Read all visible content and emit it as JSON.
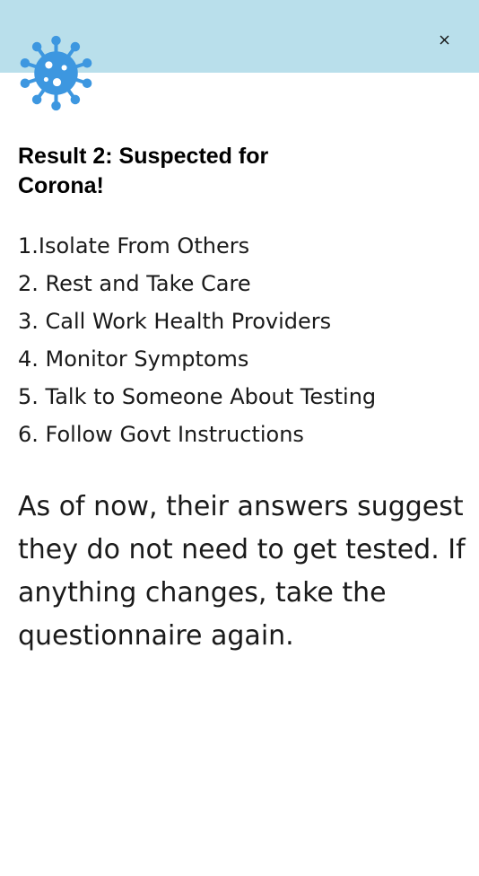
{
  "colors": {
    "header_background": "#b9dfeb",
    "virus_icon": "#3d97e0",
    "page_background": "#ffffff",
    "text": "#1a1a1a"
  },
  "header": {
    "close_label": "×",
    "close_icon": "close-icon",
    "logo_icon": "virus-icon"
  },
  "result": {
    "title": "Result 2: Suspected for Corona!"
  },
  "steps": [
    "1.Isolate From Others",
    "2. Rest and Take Care",
    "3. Call Work Health Providers",
    "4. Monitor Symptoms",
    "5. Talk to Someone About Testing",
    "6. Follow Govt Instructions"
  ],
  "advice": {
    "text": "As of now, their answers suggest they do not need to get tested. If anything changes, take the questionnaire again."
  }
}
